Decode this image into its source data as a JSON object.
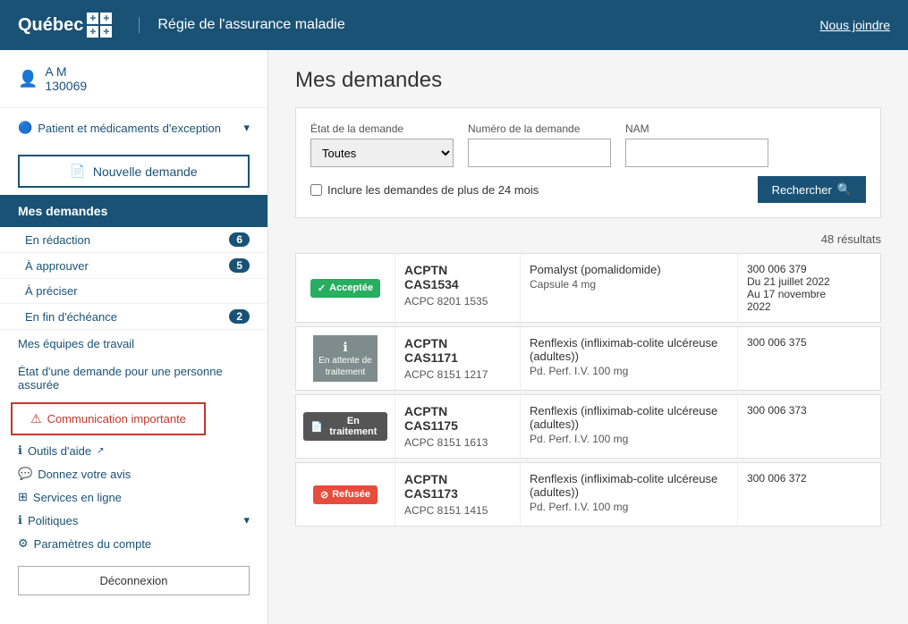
{
  "header": {
    "logo_text": "Québec",
    "title": "Régie de l'assurance maladie",
    "nav_link": "Nous joindre"
  },
  "sidebar": {
    "user": {
      "name": "A M",
      "id": "130069"
    },
    "patient_link": "Patient et médicaments d'exception",
    "new_demand_btn": "Nouvelle demande",
    "active_menu": "Mes demandes",
    "sub_items": [
      {
        "label": "En rédaction",
        "badge": "6"
      },
      {
        "label": "À approuver",
        "badge": "5"
      },
      {
        "label": "À préciser",
        "badge": null
      },
      {
        "label": "En fin d'échéance",
        "badge": "2"
      }
    ],
    "teams_link": "Mes équipes de travail",
    "etat_link": "État d'une demande pour une personne assurée",
    "communication_link": "Communication importante",
    "outils_link": "Outils d'aide",
    "donnez_link": "Donnez votre avis",
    "services_link": "Services en ligne",
    "politiques_link": "Politiques",
    "parametres_link": "Paramètres du compte",
    "deconnexion_btn": "Déconnexion"
  },
  "main": {
    "title": "Mes demandes",
    "search": {
      "etat_label": "État de la demande",
      "etat_value": "Toutes",
      "numero_label": "Numéro de la demande",
      "nam_label": "NAM",
      "checkbox_label": "Inclure les demandes de plus de 24 mois",
      "search_btn": "Rechercher"
    },
    "results_count": "48 résultats",
    "results": [
      {
        "status": "Acceptée",
        "status_class": "acceptee",
        "id_main": "ACPTN\nCAS1534",
        "id_sub": "ACPC 8201 1535",
        "desc_main": "Pomalyst (pomalidomide)",
        "desc_sub": "Capsule 4 mg",
        "meta": "300 006 379\nDu 21 juillet 2022\nAu 17 novembre\n2022"
      },
      {
        "status": "En attente de traitement",
        "status_class": "attente",
        "id_main": "ACPTN\nCAS1171",
        "id_sub": "ACPC 8151 1217",
        "desc_main": "Renflexis (infliximab-colite ulcéreuse (adultes))",
        "desc_sub": "Pd. Perf. I.V. 100 mg",
        "meta": "300 006 375"
      },
      {
        "status": "En traitement",
        "status_class": "traitement",
        "id_main": "ACPTN\nCAS1175",
        "id_sub": "ACPC 8151 1613",
        "desc_main": "Renflexis (infliximab-colite ulcéreuse (adultes))",
        "desc_sub": "Pd. Perf. I.V. 100 mg",
        "meta": "300 006 373"
      },
      {
        "status": "Refusée",
        "status_class": "refusee",
        "id_main": "ACPTN\nCAS1173",
        "id_sub": "ACPC 8151 1415",
        "desc_main": "Renflexis (infliximab-colite ulcéreuse (adultes))",
        "desc_sub": "Pd. Perf. I.V. 100 mg",
        "meta": "300 006 372"
      }
    ]
  }
}
